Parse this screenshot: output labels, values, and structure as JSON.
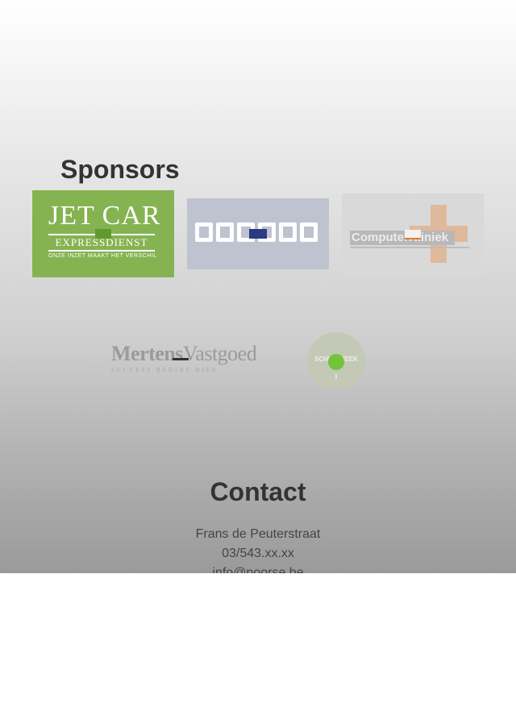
{
  "sponsors": {
    "title": "Sponsors",
    "logos": [
      {
        "name": "Jet Car Expressdienst",
        "text": "JET CAR",
        "sub": "EXPRESSDIENST",
        "tagline": "ONZE INZET MAAKT HET VERSCHIL",
        "color": "#86b351"
      },
      {
        "name": "Gamma",
        "color": "#bfc3cf",
        "loader_color": "#2b3a85"
      },
      {
        "name": "Computer Kliniek",
        "text": "ComputerKliniek",
        "accent": "#e0b89a"
      },
      {
        "name": "Mertens Vastgoed",
        "text_bold": "Mertens",
        "text_regular": "Vastgoed",
        "sub": "SUCCESS BEGINT HIER"
      },
      {
        "name": "Schuifweek",
        "text_top": "",
        "text_main": "SCHUIFWEEK",
        "accent": "#74c33b"
      }
    ]
  },
  "contact": {
    "title": "Contact",
    "address": "Frans de Peuterstraat",
    "phone": "03/543.xx.xx",
    "email": "info@poorse.be"
  }
}
